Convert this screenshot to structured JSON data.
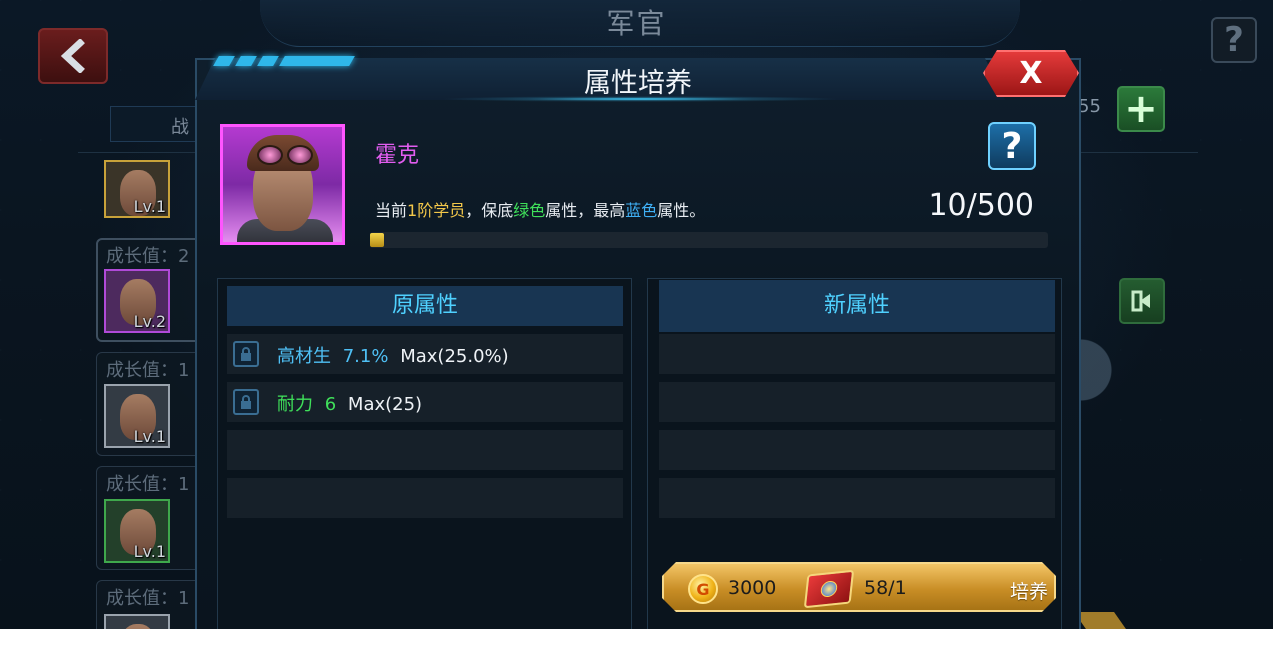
{
  "screen": {
    "title": "军官",
    "tab_label": "战",
    "count_label": "55"
  },
  "officer_list": [
    {
      "growth": "",
      "level": "Lv.1",
      "frame_color": "#c8a23a"
    },
    {
      "growth": "成长值：2",
      "level": "Lv.2",
      "frame_color": "#b04ad8"
    },
    {
      "growth": "成长值：1",
      "level": "Lv.1",
      "frame_color": "#9aa3ad"
    },
    {
      "growth": "成长值：1",
      "level": "Lv.1",
      "frame_color": "#3fa84c"
    },
    {
      "growth": "成长值：1",
      "level": "",
      "frame_color": "#9aa3ad"
    }
  ],
  "modal": {
    "title": "属性培养",
    "close_label": "X",
    "hero": {
      "name": "霍克",
      "desc_parts": [
        "当前",
        "1阶学员",
        "，保底",
        "绿色",
        "属性，最高",
        "蓝色",
        "属性。"
      ],
      "progress_text": "10/500",
      "progress_fraction": 0.02
    },
    "help_label": "?",
    "original": {
      "header": "原属性",
      "rows": [
        {
          "name": "高材生",
          "value": "7.1%",
          "max": "Max(25.0%)",
          "color": "#4fc0f5"
        },
        {
          "name": "耐力",
          "value": "6",
          "max": "Max(25)",
          "color": "#3fe05a"
        }
      ]
    },
    "new": {
      "header": "新属性"
    },
    "cultivate": {
      "coin_cost": "3000",
      "item_count": "58/1",
      "label": "培养",
      "coin_symbol": "G"
    }
  },
  "colors": {
    "accent_blue": "#4fd1ff",
    "purple_quality": "#e25df0",
    "close_red": "#e43a3a",
    "gold": "#c98e26"
  }
}
